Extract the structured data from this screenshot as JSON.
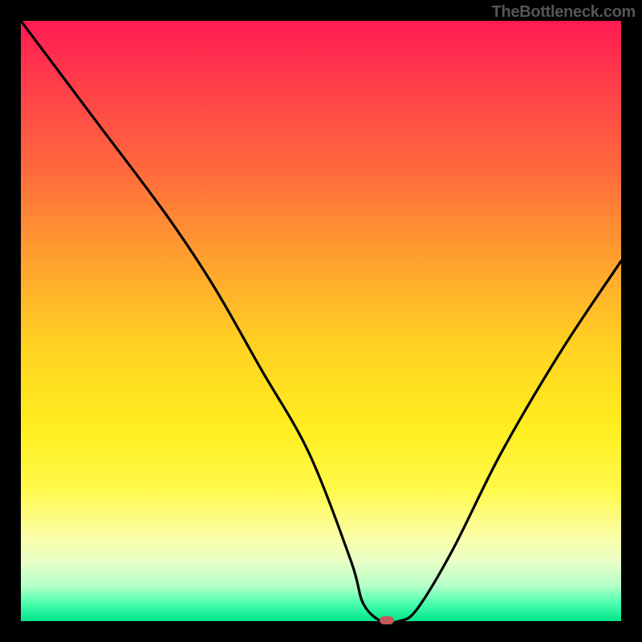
{
  "watermark": "TheBottleneck.com",
  "chart_data": {
    "type": "line",
    "title": "",
    "xlabel": "",
    "ylabel": "",
    "xlim": [
      0,
      100
    ],
    "ylim": [
      0,
      100
    ],
    "series": [
      {
        "name": "curve",
        "x": [
          0,
          12,
          24,
          32,
          40,
          48,
          55,
          57,
          60,
          63,
          66,
          72,
          80,
          90,
          100
        ],
        "y": [
          100,
          84,
          68,
          56,
          42,
          28,
          10,
          3,
          0,
          0,
          2,
          12,
          28,
          45,
          60
        ]
      }
    ],
    "marker": {
      "x": 61,
      "y": 0
    },
    "background_gradient": {
      "top": "#ff1a52",
      "mid": "#fff94a",
      "bottom": "#00e48a"
    }
  }
}
